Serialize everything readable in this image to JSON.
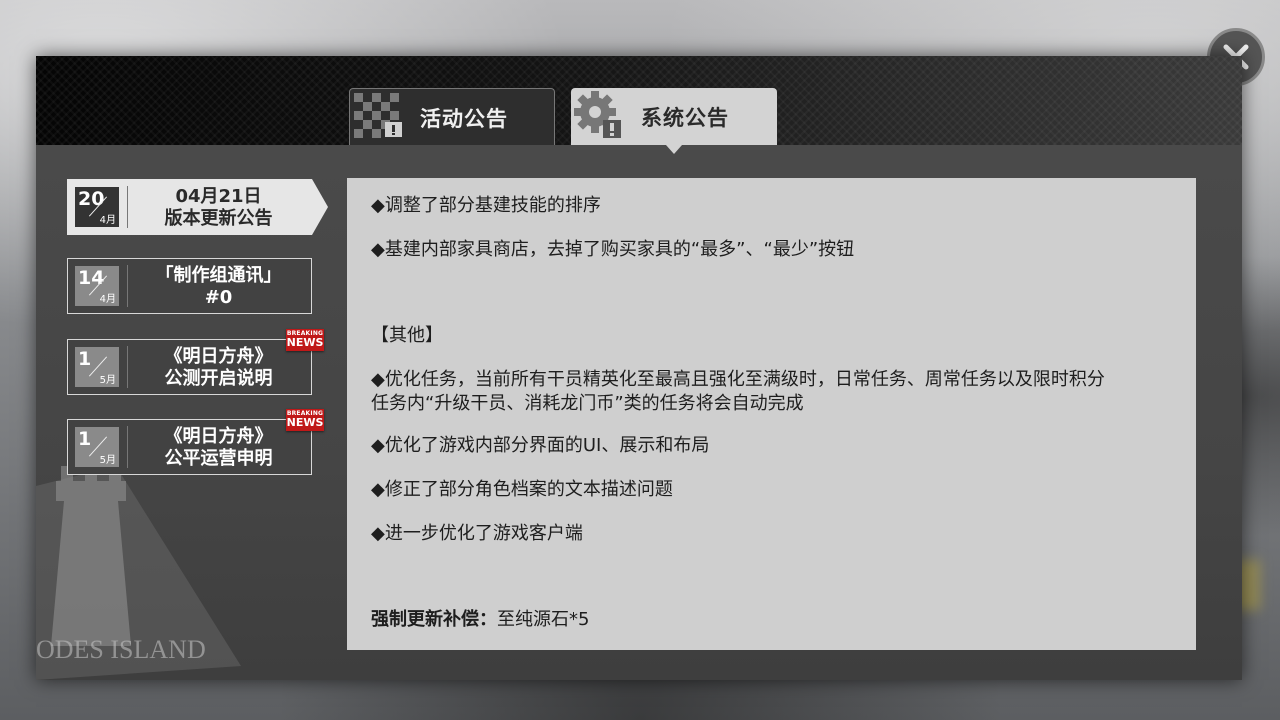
{
  "tabs": {
    "activity": {
      "label": "活动公告",
      "icon": "checkered-flag-icon"
    },
    "system": {
      "label": "系统公告",
      "icon": "gear-alert-icon"
    }
  },
  "close": {
    "icon": "close-icon"
  },
  "notices": [
    {
      "day": "20",
      "month": "4月",
      "title_line1": "04月21日",
      "title_line2": "版本更新公告",
      "active": true
    },
    {
      "day": "14",
      "month": "4月",
      "title_line1": "「制作组通讯」",
      "title_line2": "#0",
      "active": false
    },
    {
      "day": "1",
      "month": "5月",
      "title_line1": "《明日方舟》",
      "title_line2": "公测开启说明",
      "active": false,
      "badge": {
        "small": "BREAKING",
        "big": "NEWS"
      }
    },
    {
      "day": "1",
      "month": "5月",
      "title_line1": "《明日方舟》",
      "title_line2": "公平运营申明",
      "active": false,
      "badge": {
        "small": "BREAKING",
        "big": "NEWS"
      }
    }
  ],
  "emblem": {
    "text": "ODES ISLAND"
  },
  "content": {
    "lines": [
      "◆调整了部分基建技能的排序",
      "◆基建内部家具商店，去掉了购买家具的“最多”、“最少”按钮",
      "【其他】",
      "◆优化任务，当前所有干员精英化至最高且强化至满级时，日常任务、周常任务以及限时积分",
      "任务内“升级干员、消耗龙门币”类的任务将会自动完成",
      "◆优化了游戏内部分界面的UI、展示和布局",
      "◆修正了部分角色档案的文本描述问题",
      "◆进一步优化了游戏客户端"
    ],
    "compensation_label": "强制更新补偿：",
    "compensation_value": "至纯源石*5"
  }
}
